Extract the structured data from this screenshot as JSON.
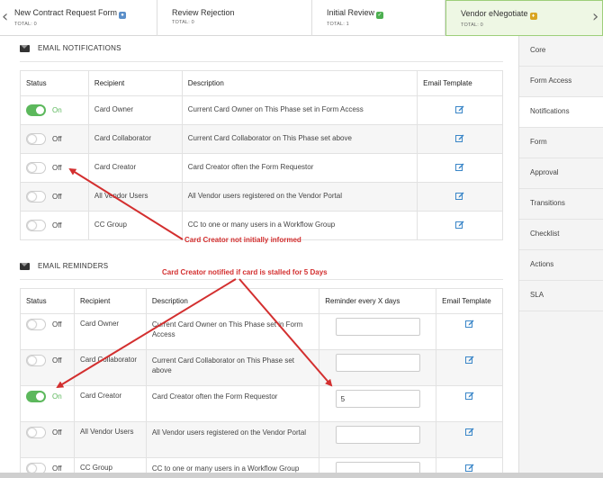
{
  "phases": [
    {
      "name": "New Contract Request Form",
      "total": "TOTAL: 0",
      "badge": "blue",
      "badge_icon": "globe-icon"
    },
    {
      "name": "Review Rejection",
      "total": "TOTAL: 0"
    },
    {
      "name": "Initial Review",
      "total": "TOTAL: 1",
      "badge": "green",
      "badge_icon": "check-icon"
    },
    {
      "name": "Vendor eNegotiate",
      "total": "TOTAL: 0",
      "badge": "gold",
      "badge_icon": "person-icon",
      "active": true
    }
  ],
  "sidemenu": {
    "items": [
      {
        "label": "Core"
      },
      {
        "label": "Form Access"
      },
      {
        "label": "Notifications",
        "active": true
      },
      {
        "label": "Form"
      },
      {
        "label": "Approval"
      },
      {
        "label": "Transitions"
      },
      {
        "label": "Checklist"
      },
      {
        "label": "Actions"
      },
      {
        "label": "SLA"
      }
    ]
  },
  "notifications": {
    "title": "EMAIL NOTIFICATIONS",
    "headers": {
      "status": "Status",
      "recipient": "Recipient",
      "description": "Description",
      "template": "Email Template"
    },
    "rows": [
      {
        "status": "On",
        "recipient": "Card Owner",
        "description": "Current Card Owner on This Phase set in Form Access"
      },
      {
        "status": "Off",
        "recipient": "Card Collaborator",
        "description": "Current Card Collaborator on This Phase set above"
      },
      {
        "status": "Off",
        "recipient": "Card Creator",
        "description": "Card Creator often the Form Requestor"
      },
      {
        "status": "Off",
        "recipient": "All Vendor Users",
        "description": "All Vendor users registered on the Vendor Portal"
      },
      {
        "status": "Off",
        "recipient": "CC Group",
        "description": "CC to one or many users in a Workflow Group"
      }
    ]
  },
  "reminders": {
    "title": "EMAIL REMINDERS",
    "headers": {
      "status": "Status",
      "recipient": "Recipient",
      "description": "Description",
      "reminder": "Reminder every X days",
      "template": "Email Template"
    },
    "rows": [
      {
        "status": "Off",
        "recipient": "Card Owner",
        "description": "Current Card Owner on This Phase set in Form Access",
        "days": ""
      },
      {
        "status": "Off",
        "recipient": "Card Collaborator",
        "description": "Current Card Collaborator on This Phase set above",
        "days": ""
      },
      {
        "status": "On",
        "recipient": "Card Creator",
        "description": "Card Creator often the Form Requestor",
        "days": "5"
      },
      {
        "status": "Off",
        "recipient": "All Vendor Users",
        "description": "All Vendor users registered on the Vendor Portal",
        "days": ""
      },
      {
        "status": "Off",
        "recipient": "CC Group",
        "description": "CC to one or many users in a Workflow Group",
        "days": ""
      }
    ]
  },
  "annotations": {
    "note1": "Card Creator not initially informed",
    "note2": "Card Creator notified if card is stalled for 5 Days"
  },
  "colors": {
    "toggle_on": "#5cb85c",
    "annotation": "#d32f2f",
    "edit_icon": "#3a86c8",
    "active_phase_bg": "#eef7e4"
  }
}
